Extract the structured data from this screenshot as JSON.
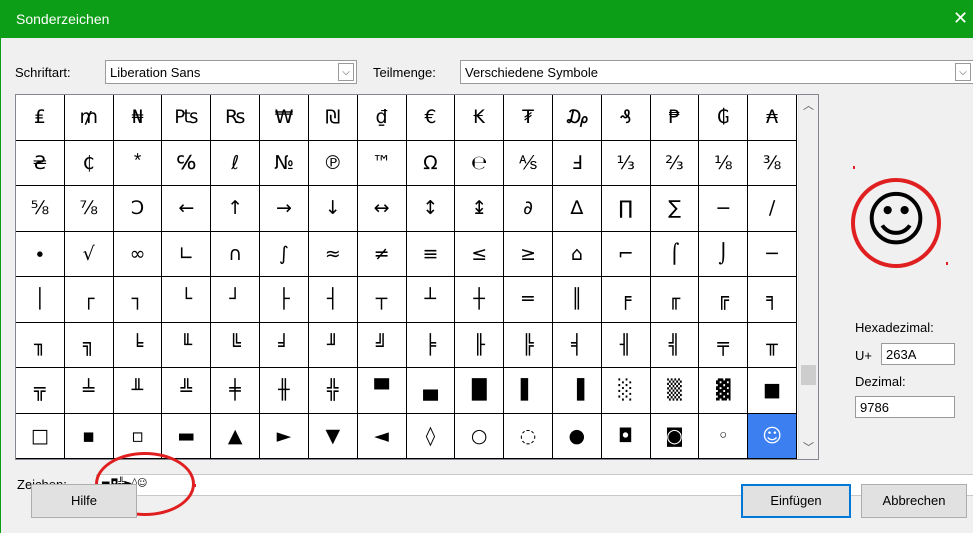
{
  "dialog": {
    "title": "Sonderzeichen",
    "close": "✕"
  },
  "font_label": "Schriftart:",
  "font_value": "Liberation Sans",
  "subset_label": "Teilmenge:",
  "subset_value": "Verschiedene Symbole",
  "grid_rows": [
    [
      "₤",
      "₥",
      "₦",
      "₧",
      "₨",
      "₩",
      "₪",
      "₫",
      "€",
      "₭",
      "₮",
      "₯",
      "₰",
      "₱",
      "₲",
      "₳"
    ],
    [
      "₴",
      "₵",
      "⃰",
      "℅",
      "ℓ",
      "№",
      "℗",
      "™",
      "Ω",
      "℮",
      "⅍",
      "Ⅎ",
      "⅓",
      "⅔",
      "⅛",
      "⅜"
    ],
    [
      "⅝",
      "⅞",
      "Ↄ",
      "←",
      "↑",
      "→",
      "↓",
      "↔",
      "↕",
      "↨",
      "∂",
      "∆",
      "∏",
      "∑",
      "−",
      "∕"
    ],
    [
      "∙",
      "√",
      "∞",
      "∟",
      "∩",
      "∫",
      "≈",
      "≠",
      "≡",
      "≤",
      "≥",
      "⌂",
      "⌐",
      "⌠",
      "⌡",
      "─"
    ],
    [
      "│",
      "┌",
      "┐",
      "└",
      "┘",
      "├",
      "┤",
      "┬",
      "┴",
      "┼",
      "═",
      "║",
      "╒",
      "╓",
      "╔",
      "╕"
    ],
    [
      "╖",
      "╗",
      "╘",
      "╙",
      "╚",
      "╛",
      "╜",
      "╝",
      "╞",
      "╟",
      "╠",
      "╡",
      "╢",
      "╣",
      "╤",
      "╥"
    ],
    [
      "╦",
      "╧",
      "╨",
      "╩",
      "╪",
      "╫",
      "╬",
      "▀",
      "▄",
      "█",
      "▌",
      "▐",
      "░",
      "▒",
      "▓",
      "■"
    ],
    [
      "□",
      "▪",
      "▫",
      "▬",
      "▲",
      "►",
      "▼",
      "◄",
      "◊",
      "○",
      "◌",
      "●",
      "◘",
      "◙",
      "◦",
      "☺"
    ]
  ],
  "selected_char": "☺",
  "hex_label": "Hexadezimal:",
  "hex_prefix": "U+",
  "hex_value": "263A",
  "dec_label": "Dezimal:",
  "dec_value": "9786",
  "chars_label": "Zeichen:",
  "chars_value": "▬◘╬►◊☺",
  "buttons": {
    "help": "Hilfe",
    "insert": "Einfügen",
    "cancel": "Abbrechen"
  }
}
